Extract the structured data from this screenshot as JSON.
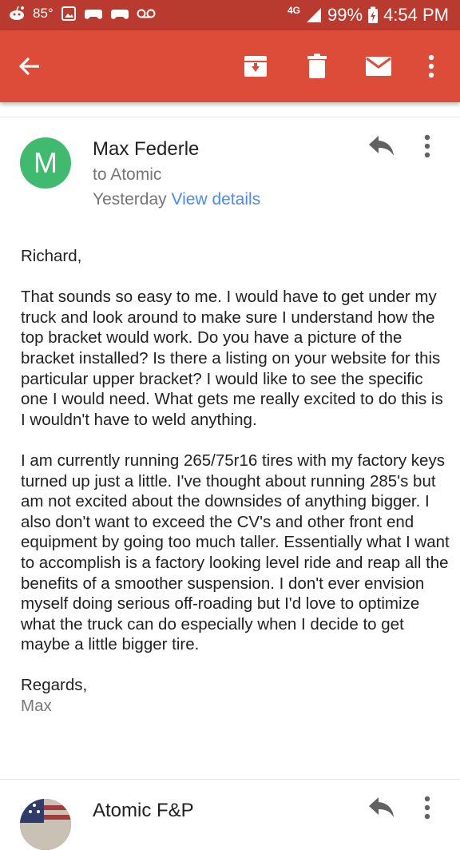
{
  "status_bar": {
    "temperature": "85°",
    "network": "4G",
    "battery": "99%",
    "time": "4:54 PM",
    "icons": [
      "reddit-icon",
      "image-icon",
      "gamepad-icon",
      "gamepad-icon",
      "voicemail-icon",
      "signal-icon",
      "battery-charging-icon"
    ]
  },
  "toolbar": {
    "icons": [
      "back-arrow-icon",
      "archive-icon",
      "delete-icon",
      "mail-icon",
      "more-vert-icon"
    ],
    "color": "#dd4b39"
  },
  "message": {
    "avatar_letter": "M",
    "avatar_color": "#3fba6f",
    "sender": "Max Federle",
    "to": "to Atomic",
    "date": "Yesterday",
    "view_details": "View details",
    "greeting": "Richard,",
    "paragraph1": "That sounds so easy to me. I would have to get under my truck and look around to make sure I understand how the top bracket would work. Do you have a picture of the bracket installed? Is there a listing on your website for this particular upper bracket? I would like to see the specific one I would need. What gets me really excited to do this is I wouldn't have to weld anything.",
    "paragraph2": "I am currently running 265/75r16 tires with my factory keys turned up just a little. I've thought about running 285's but am not excited about the downsides of anything bigger. I also don't want to exceed the CV's and other front end equipment by going too much taller. Essentially what I want to accomplish is a factory looking level ride and reap all the benefits of a smoother suspension. I don't ever envision myself doing serious off-roading but I'd love to optimize what the truck can do especially when I decide to get maybe a little bigger tire.",
    "closing": "Regards,",
    "signature": "Max"
  },
  "next_message": {
    "sender": "Atomic F&P"
  }
}
